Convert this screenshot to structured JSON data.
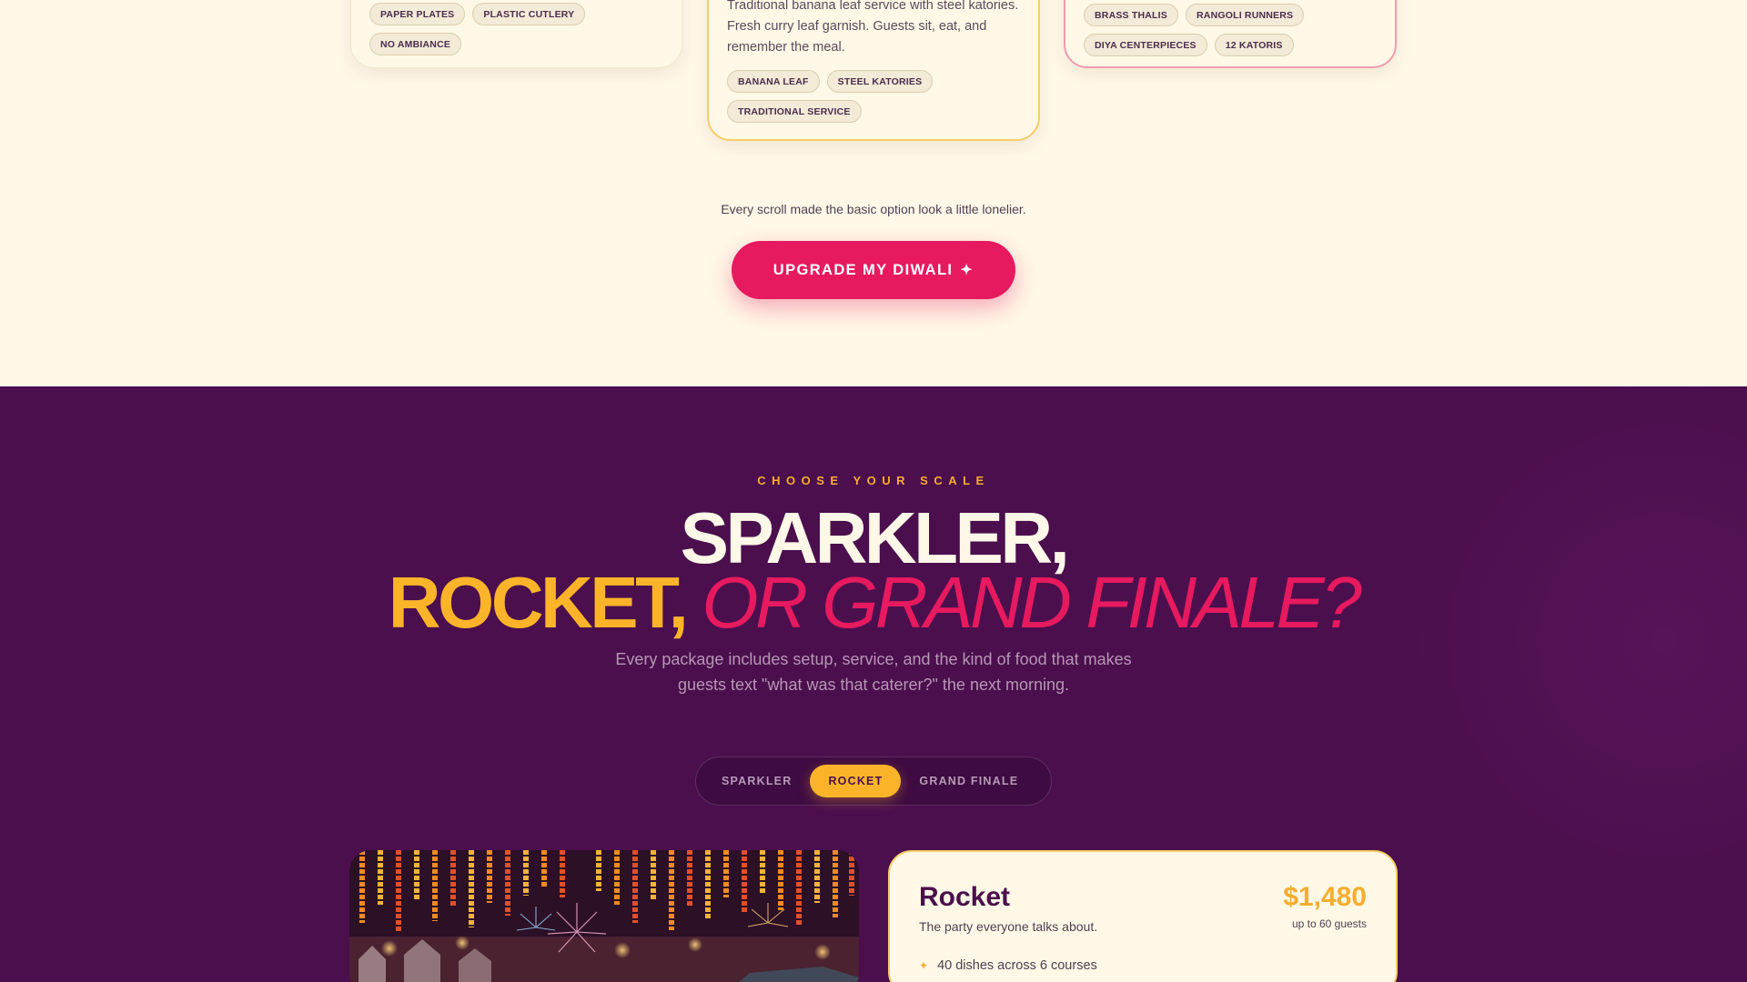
{
  "top_cards": {
    "left": {
      "tags": [
        "PAPER PLATES",
        "PLASTIC CUTLERY",
        "NO AMBIANCE"
      ]
    },
    "middle": {
      "description": "Traditional banana leaf service with steel katories. Fresh curry leaf garnish. Guests sit, eat, and remember the meal.",
      "tags": [
        "BANANA LEAF",
        "STEEL KATORIES",
        "TRADITIONAL SERVICE"
      ]
    },
    "right": {
      "tags": [
        "BRASS THALIS",
        "RANGOLI RUNNERS",
        "DIYA CENTERPIECES",
        "12 KATORIS"
      ]
    }
  },
  "comparison_note": "Every scroll made the basic option look a little lonelier.",
  "cta": {
    "label": "UPGRADE MY DIWALI",
    "icon": "sparkle-icon",
    "glyph": "✦"
  },
  "scale_section": {
    "eyebrow": "CHOOSE YOUR SCALE",
    "headline_line1": "SPARKLER,",
    "headline_rocket": "ROCKET,",
    "headline_finale": "OR GRAND FINALE?",
    "subtitle": "Every package includes setup, service, and the kind of food that makes guests text \"what was that caterer?\" the next morning.",
    "tabs": [
      {
        "label": "SPARKLER",
        "active": false
      },
      {
        "label": "ROCKET",
        "active": true
      },
      {
        "label": "GRAND FINALE",
        "active": false
      }
    ],
    "package": {
      "name": "Rocket",
      "tagline": "The party everyone talks about.",
      "price": "$1,480",
      "guests": "up to 60 guests",
      "features": [
        "40 dishes across 6 courses"
      ],
      "feature_icon_glyph": "✦"
    }
  },
  "colors": {
    "cream": "#fff8e8",
    "plum": "#4b0f4d",
    "marigold": "#fbb429",
    "rose": "#e7195f"
  }
}
